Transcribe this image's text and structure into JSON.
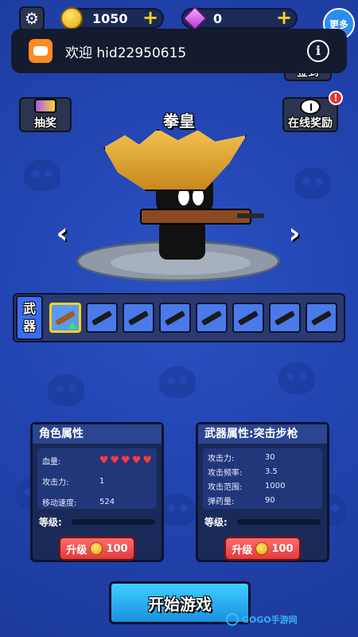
{
  "topbar": {
    "coins": "1050",
    "gems": "0",
    "more_label": "更多"
  },
  "notification": {
    "text": "欢迎 hid22950615"
  },
  "side_buttons": {
    "lottery_label": "抽奖",
    "checkin_label": "签到",
    "online_reward_label": "在线奖励",
    "online_reward_badge": "!"
  },
  "character": {
    "name": "拳皇"
  },
  "weapons": {
    "label_line1": "武",
    "label_line2": "器",
    "slots": [
      {
        "icon": "assault-rifle",
        "selected": true
      },
      {
        "icon": "pistol",
        "selected": false
      },
      {
        "icon": "smg",
        "selected": false
      },
      {
        "icon": "shotgun",
        "selected": false
      },
      {
        "icon": "rifle",
        "selected": false
      },
      {
        "icon": "laser-gun",
        "selected": false
      },
      {
        "icon": "sniper-rifle",
        "selected": false
      },
      {
        "icon": "rocket-launcher",
        "selected": false
      }
    ]
  },
  "character_panel": {
    "title": "角色属性",
    "hp_label": "血量:",
    "hearts": 5,
    "attack_label": "攻击力:",
    "attack_value": "1",
    "speed_label": "移动速度:",
    "speed_value": "524",
    "level_label": "等级:",
    "level_progress": 0,
    "upgrade_label": "升级",
    "upgrade_cost": "100"
  },
  "weapon_panel": {
    "title": "武器属性:突击步枪",
    "attack_label": "攻击力:",
    "attack_value": "30",
    "rate_label": "攻击频率:",
    "rate_value": "3.5",
    "range_label": "攻击范围:",
    "range_value": "1000",
    "ammo_label": "弹药量:",
    "ammo_value": "90",
    "level_label": "等级:",
    "level_progress": 0,
    "upgrade_label": "升级",
    "upgrade_cost": "100"
  },
  "start_button": {
    "label": "开始游戏"
  },
  "watermark": {
    "text": "GOGO手游网"
  },
  "colors": {
    "background": "#2346b3",
    "start_button": "#2aaef0",
    "upgrade_button": "#e94444",
    "coin": "#f5c22c",
    "gem": "#d05ef0"
  }
}
